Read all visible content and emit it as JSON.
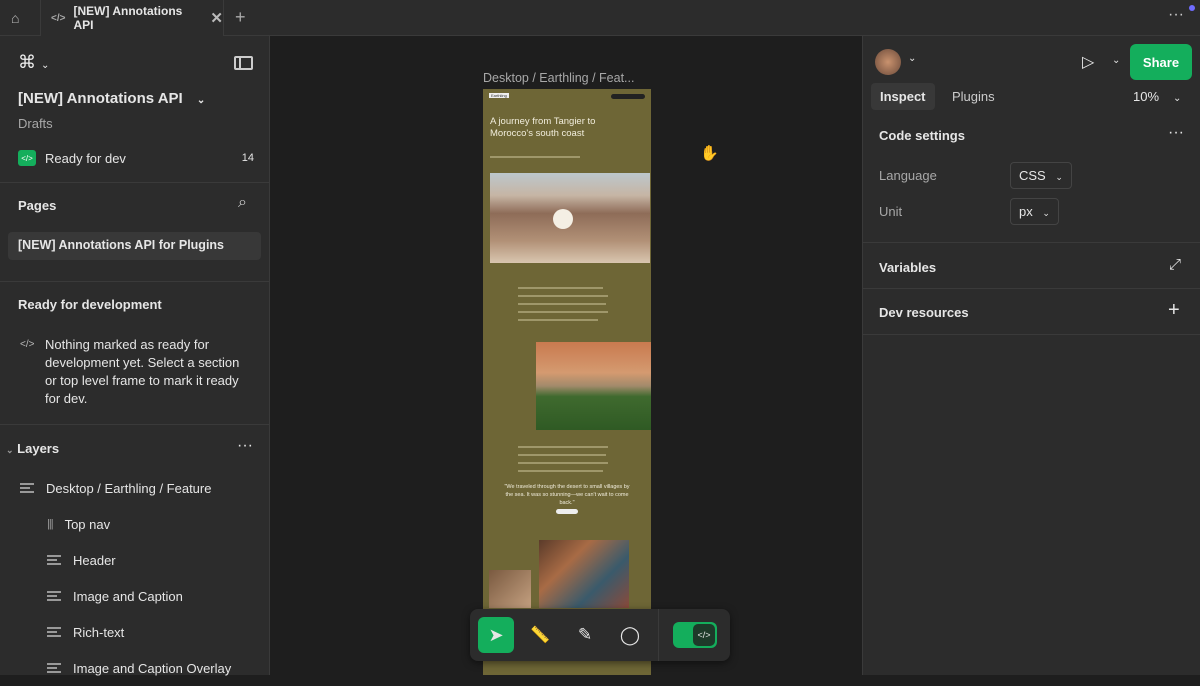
{
  "tabs": {
    "active_title": "[NEW] Annotations API"
  },
  "file": {
    "name": "[NEW] Annotations API",
    "location": "Drafts",
    "ready_label": "Ready for dev",
    "ready_count": "14"
  },
  "pages": {
    "heading": "Pages",
    "items": [
      "[NEW] Annotations API for Plugins"
    ]
  },
  "ready_section": {
    "heading": "Ready for development",
    "empty_text": "Nothing marked as ready for development yet. Select a section or top level frame to mark it ready for dev."
  },
  "layers": {
    "heading": "Layers",
    "root": "Desktop / Earthling / Feature",
    "items": [
      "Top nav",
      "Header",
      "Image and Caption",
      "Rich-text",
      "Image and Caption Overlay"
    ]
  },
  "canvas": {
    "frame_label": "Desktop / Earthling / Feat...",
    "brand": "Earthling",
    "headline": "A journey from Tangier to Morocco's south coast",
    "quote": "\"We traveled through the desert to small villages by the sea. It was so stunning—we can't wait to come back.\""
  },
  "right": {
    "tabs": [
      "Inspect",
      "Plugins"
    ],
    "zoom": "10%",
    "share": "Share",
    "code_settings": "Code settings",
    "language_label": "Language",
    "language_value": "CSS",
    "unit_label": "Unit",
    "unit_value": "px",
    "variables": "Variables",
    "dev_resources": "Dev resources"
  },
  "help": "?",
  "colors": {
    "accent": "#14ae5c",
    "frame": "#6e6636"
  }
}
